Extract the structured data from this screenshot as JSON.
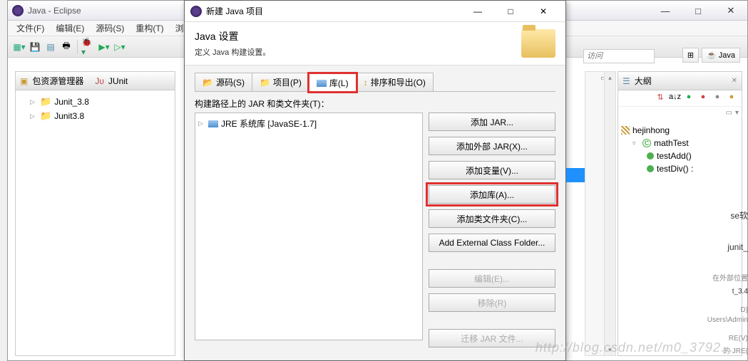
{
  "eclipse": {
    "title": "Java - Eclipse",
    "menus": [
      "文件(F)",
      "编辑(E)",
      "源码(S)",
      "重构(T)",
      "浏览"
    ],
    "searchPlaceholder": "访问",
    "perspective": "Java"
  },
  "packageExplorer": {
    "title": "包资源管理器",
    "secondTab": "JUnit",
    "items": [
      "Junit_3.8",
      "Junit3.8"
    ]
  },
  "dialog": {
    "title": "新建 Java 项目",
    "heading": "Java 设置",
    "subheading": "定义 Java 构建设置。",
    "tabs": {
      "source": "源码(S)",
      "projects": "项目(P)",
      "libraries": "库(L)",
      "order": "排序和导出(O)"
    },
    "buildLabel": "构建路径上的 JAR 和类文件夹(T)：",
    "jre": "JRE 系统库 [JavaSE-1.7]",
    "buttons": {
      "addJar": "添加 JAR...",
      "addExtJar": "添加外部 JAR(X)...",
      "addVar": "添加变量(V)...",
      "addLib": "添加库(A)...",
      "addClassFolder": "添加类文件夹(C)...",
      "addExtClassFolder": "Add External Class Folder...",
      "edit": "编辑(E)...",
      "remove": "移除(R)",
      "migrate": "迁移 JAR 文件..."
    }
  },
  "outline": {
    "title": "大纲",
    "pkg": "hejinhong",
    "cls": "mathTest",
    "methods": [
      "testAdd()",
      "testDiv() :"
    ]
  },
  "stray": {
    "se": "se软",
    "junit": "junit_",
    "loc": "在外部位置",
    "t34": "t_3.4",
    "d": "D)",
    "admin": "Users\\Admin",
    "rev": "RE(V)",
    "jre": "的 JRE("
  },
  "watermark": "http://blog.csdn.net/m0_3792..."
}
